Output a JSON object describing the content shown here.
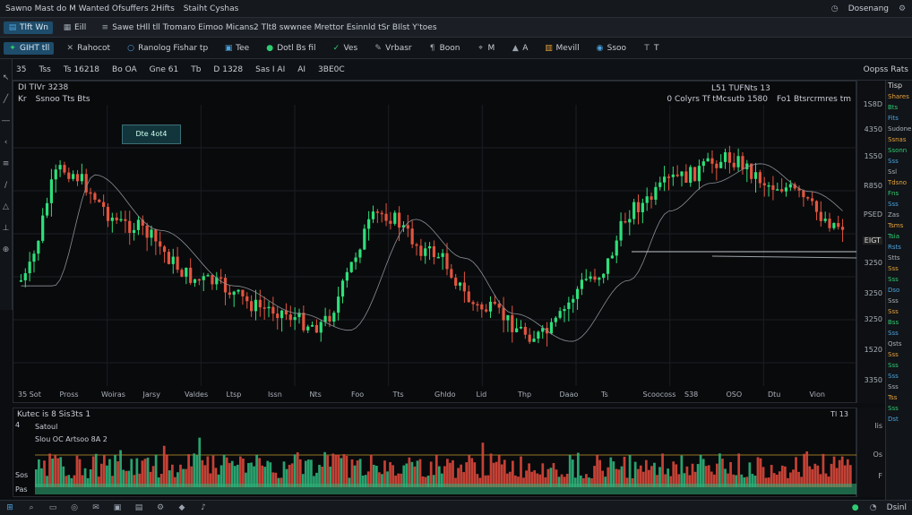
{
  "window": {
    "title": "Sawno Mast do M Wanted Ofsuffers 2Hifts",
    "subtitle": "Staiht Cyshas",
    "app_label": "Dosenang"
  },
  "toolbar1": {
    "items": [
      {
        "label": "Tlft Wn",
        "icon": "chart-icon"
      },
      {
        "label": "Eill",
        "icon": "table-icon"
      },
      {
        "label": "Sawe tHll tll Tromaro Eimoo Micans2 Tlt8 swwnee Mrettor Esinnld tSr BIlst Y'toes",
        "icon": "menu-icon"
      }
    ]
  },
  "toolbar2": {
    "items": [
      {
        "label": "GIHT tll",
        "icon": "cursor-icon",
        "highlight": true
      },
      {
        "label": "Rahocot",
        "icon": "crosshair-icon"
      },
      {
        "label": "Ranolog Fishar tp",
        "icon": "circle-icon"
      },
      {
        "label": "Tee",
        "icon": "layout-icon"
      },
      {
        "label": "Dotl Bs fil",
        "icon": "grid-icon"
      },
      {
        "label": "Ves",
        "icon": "check-icon"
      },
      {
        "label": "Vrbasr",
        "icon": "pencil-icon"
      },
      {
        "label": "Boon",
        "icon": "text-icon"
      },
      {
        "label": "M",
        "icon": "measure-icon"
      },
      {
        "label": "A",
        "icon": "alert-icon"
      },
      {
        "label": "Mevill",
        "icon": "replay-icon"
      },
      {
        "label": "Ssoo",
        "icon": "camera-icon"
      },
      {
        "label": "T",
        "icon": "text-tool-icon"
      }
    ]
  },
  "toolbar3": {
    "items": [
      "35",
      "Tss",
      "Ts 16218",
      "Bo OA",
      "Gne 61",
      "Tb",
      "D 1328",
      "Sas I AI",
      "AI",
      "3BE0C"
    ],
    "right_label": "Oopss Rats"
  },
  "chart": {
    "symbol": "DI TIVr 3238",
    "interval": "Ssnoo Tts Bts",
    "timeframe": "Kr",
    "ohlc_label": "0 Colyrs Tf tMcsutb 1580",
    "center_label": "L51 TUFNts 13",
    "right_label": "Fo1 Btsrcrmres tm",
    "marker_box": "Dte 4ot4",
    "colors": {
      "up": "#2ee07a",
      "down": "#e2553f",
      "ma": "#8a8f96"
    }
  },
  "price_axis": {
    "labels": [
      "1S8D",
      "4350",
      "1S50",
      "R850",
      "PSED",
      "EIGT",
      "3250",
      "3250",
      "1520",
      "3350"
    ],
    "current": "3250"
  },
  "x_axis": {
    "labels": [
      "35 Sot",
      "Pross",
      "Woiras",
      "Jarsy",
      "Valdes",
      "Ltsp",
      "Issn",
      "Nts",
      "Foo",
      "Tts",
      "Ghldo",
      "Lid",
      "Thp",
      "Daao",
      "Ts",
      "Scoocoss",
      "S38",
      "OSO",
      "Dtu",
      "Vion"
    ]
  },
  "volume": {
    "header": "Kutec is 8 Sis3ts 1",
    "sub1": "Satoul",
    "sub2": "Slou OC Artsoo 8A 2",
    "right_label": "Tl 13",
    "axis_labels": [
      "Iis",
      "Os",
      "F"
    ],
    "left_labels": [
      "4",
      "Sos",
      "Pas"
    ],
    "colors": {
      "up": "#2fb27a",
      "down": "#d9473a"
    }
  },
  "sidebar": {
    "title": "Tisp",
    "items": [
      "Shares",
      "Bts",
      "Fits",
      "Sudone",
      "Ssnas",
      "Ssonn",
      "Sss",
      "Ssl",
      "Tdsno",
      "Fns",
      "Sss",
      "Zas",
      "Tsms",
      "Tsia",
      "Rsts",
      "Stts",
      "Sss",
      "Sss",
      "Dso",
      "Sss",
      "Sss",
      "Bss",
      "Sss",
      "Qsts",
      "Sss",
      "Sss",
      "Sss",
      "Sss",
      "Tss",
      "Sss",
      "Dst"
    ]
  },
  "taskbar": {
    "clock": "Dsinl",
    "icons": [
      "windows-icon",
      "search-icon",
      "folder-icon",
      "browser-icon",
      "mail-icon",
      "terminal-icon",
      "chart-icon",
      "settings-icon",
      "store-icon",
      "music-icon"
    ]
  }
}
